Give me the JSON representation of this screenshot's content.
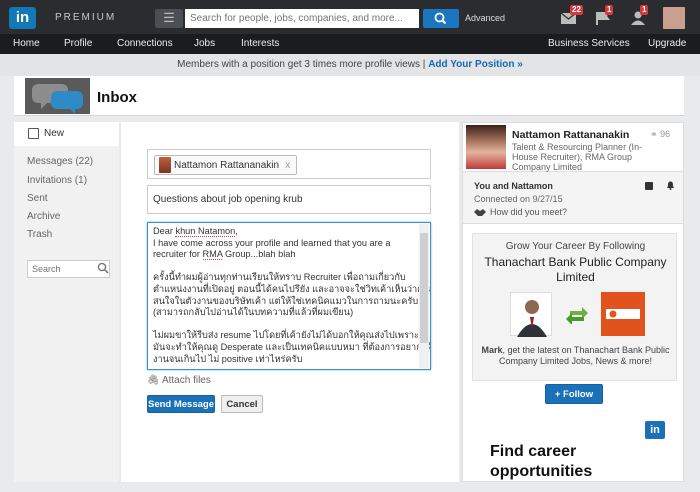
{
  "topbar": {
    "logo": "in",
    "premium": "PREMIUM",
    "search_placeholder": "Search for people, jobs, companies, and more...",
    "advanced": "Advanced",
    "badges": {
      "messages": "22",
      "notifications": "1",
      "connections": "1"
    }
  },
  "nav": {
    "items": [
      "Home",
      "Profile",
      "Connections",
      "Jobs",
      "Interests"
    ],
    "business_services": "Business Services",
    "upgrade": "Upgrade"
  },
  "notice": {
    "text": "Members with a position get 3 times more profile views |",
    "link": "Add Your Position »"
  },
  "inbox": {
    "title": "Inbox"
  },
  "sidebar": {
    "new": "New",
    "items": [
      "Messages (22)",
      "Invitations (1)",
      "Sent",
      "Archive",
      "Trash"
    ],
    "search_placeholder": "Search"
  },
  "compose": {
    "recipient": "Nattamon Rattananakin",
    "recipient_remove": "x",
    "subject": "Questions about job opening krub",
    "body_lines": [
      "Dear khun Natamon,",
      "I have come across your profile and learned that you are a",
      "recruiter for RMA Group...blah blah",
      "",
      "ครั้งนี้ทำผมผู้อ่านทุกท่านเรียนให้ทราบ Recruiter เพื่อถามเกี่ยวกับ",
      "ตำแหน่งงานที่เปิดอยู่ ตอนนี้ได้คนไปรึยัง และอาจจะใช่วิทเค้าเห็นว่าคุณ",
      "สนใจในตัวงานของบริษัทเค้า แต่ให้ใช่เทคนิคแมวในการถามนะครับ",
      "(สามารถกลับไปอ่านได้ในบทความที่แล้วที่ผมเขียน)",
      "",
      "ไม่ผมขาให้รีบส่ง resume ไปโดยที่เค้ายังไม่ได้บอกให้คุณส่งไปเพราะ",
      "มันจะทำให้คุณดู Desperate และเป็นเทคนิคแบบหมา ที่ต้องการอยากได้",
      "งานจนเกินไป ไม่ positive เท่าไหร่ครับ"
    ],
    "attach": "Attach files",
    "send": "Send Message",
    "cancel": "Cancel"
  },
  "profile": {
    "name": "Nattamon Rattananakin",
    "title": "Talent & Resourcing Planner (In-House Recruiter), RMA Group Company Limited",
    "connections": "96"
  },
  "relationship": {
    "heading": "You and Nattamon",
    "connected": "Connected on 9/27/15",
    "how_met": "How did you meet?"
  },
  "ad": {
    "headline": "Grow Your Career By Following",
    "company": "Thanachart Bank Public Company Limited",
    "text_name": "Mark",
    "text_rest": ", get the latest on Thanachart Bank Public Company Limited Jobs, News & more!",
    "follow": "+ Follow",
    "logo": "in",
    "find_career": "Find career opportunities"
  },
  "colors": {
    "accent": "#1b71b8",
    "topbar": "#2a2c2f",
    "badge": "#d9383a"
  }
}
